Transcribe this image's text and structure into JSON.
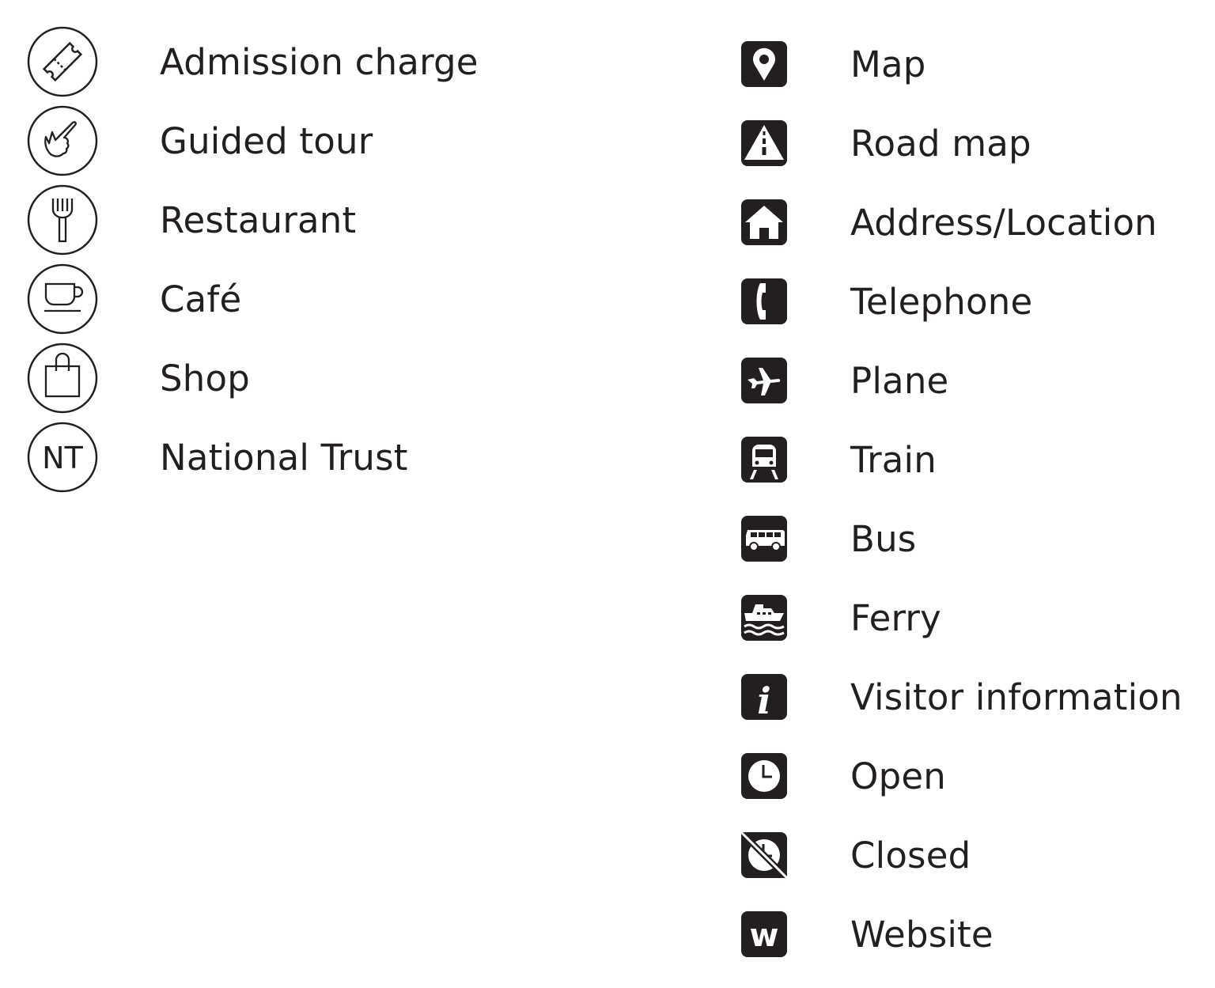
{
  "left_items": [
    {
      "label": "Admission charge",
      "icon": "ticket-icon"
    },
    {
      "label": "Guided tour",
      "icon": "pointing-hand-icon"
    },
    {
      "label": "Restaurant",
      "icon": "fork-icon"
    },
    {
      "label": "Café",
      "icon": "coffee-cup-icon"
    },
    {
      "label": "Shop",
      "icon": "shopping-bag-icon"
    },
    {
      "label": "National Trust",
      "icon": "national-trust-icon",
      "icon_text": "NT"
    }
  ],
  "right_items": [
    {
      "label": "Map",
      "icon": "map-pin-icon"
    },
    {
      "label": "Road map",
      "icon": "road-icon"
    },
    {
      "label": "Address/Location",
      "icon": "house-icon"
    },
    {
      "label": "Telephone",
      "icon": "telephone-icon"
    },
    {
      "label": "Plane",
      "icon": "plane-icon"
    },
    {
      "label": "Train",
      "icon": "train-icon"
    },
    {
      "label": "Bus",
      "icon": "bus-icon"
    },
    {
      "label": "Ferry",
      "icon": "ferry-icon"
    },
    {
      "label": "Visitor information",
      "icon": "info-icon",
      "icon_text": "i"
    },
    {
      "label": "Open",
      "icon": "clock-icon"
    },
    {
      "label": "Closed",
      "icon": "clock-crossed-icon"
    },
    {
      "label": "Website",
      "icon": "website-icon",
      "icon_text": "w"
    }
  ],
  "colors": {
    "ink": "#231f20",
    "background": "#ffffff"
  }
}
